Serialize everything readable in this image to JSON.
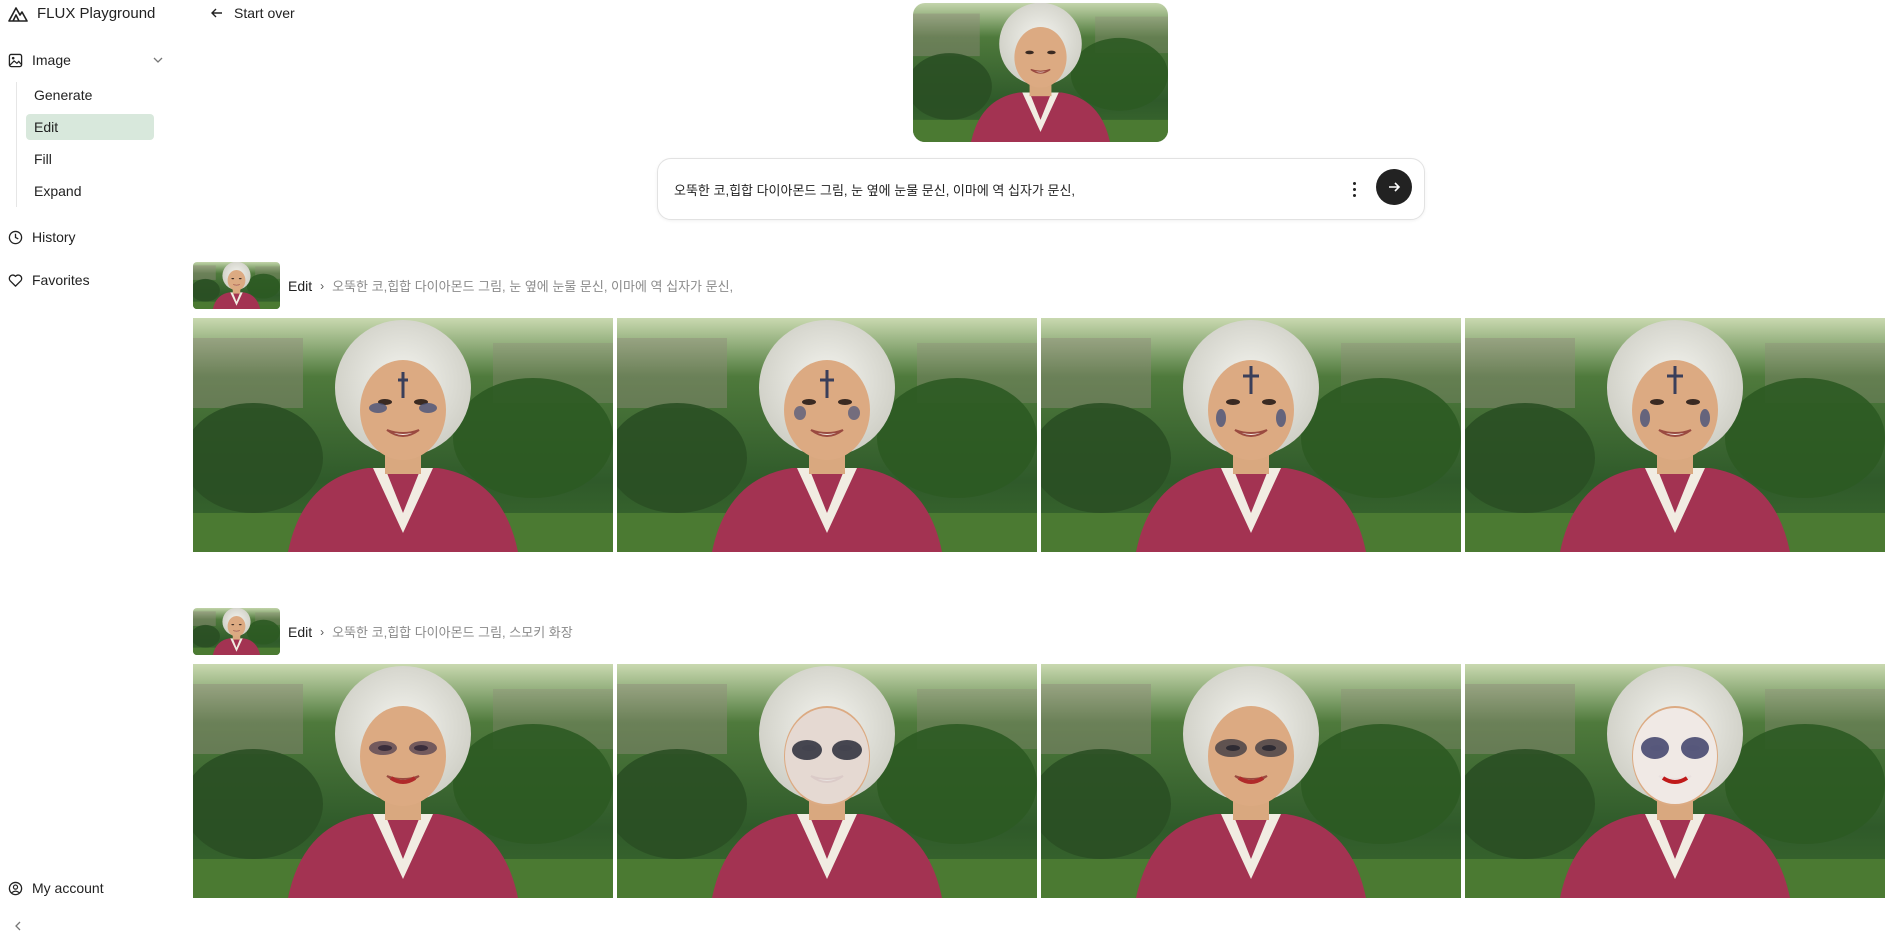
{
  "app": {
    "title": "FLUX Playground"
  },
  "sidebar": {
    "group_label": "Image",
    "items": [
      {
        "label": "Generate"
      },
      {
        "label": "Edit"
      },
      {
        "label": "Fill"
      },
      {
        "label": "Expand"
      }
    ],
    "history_label": "History",
    "favorites_label": "Favorites",
    "account_label": "My account"
  },
  "toolbar": {
    "start_over_label": "Start over"
  },
  "prompt": {
    "value": "오뚝한 코,힙합 다이아몬드 그림, 눈 옆에 눈물 문신, 이마에 역 십자가 문신,"
  },
  "groups": [
    {
      "crumb": "Edit",
      "prompt": "오뚝한 코,힙합 다이아몬드 그림, 눈 옆에 눈물 문신, 이마에 역 십자가 문신,"
    },
    {
      "crumb": "Edit",
      "prompt": "오뚝한 코,힙합 다이아몬드 그림, 스모키 화장"
    }
  ],
  "colors": {
    "active_nav": "#d8e8dc",
    "send_button": "#222222"
  }
}
